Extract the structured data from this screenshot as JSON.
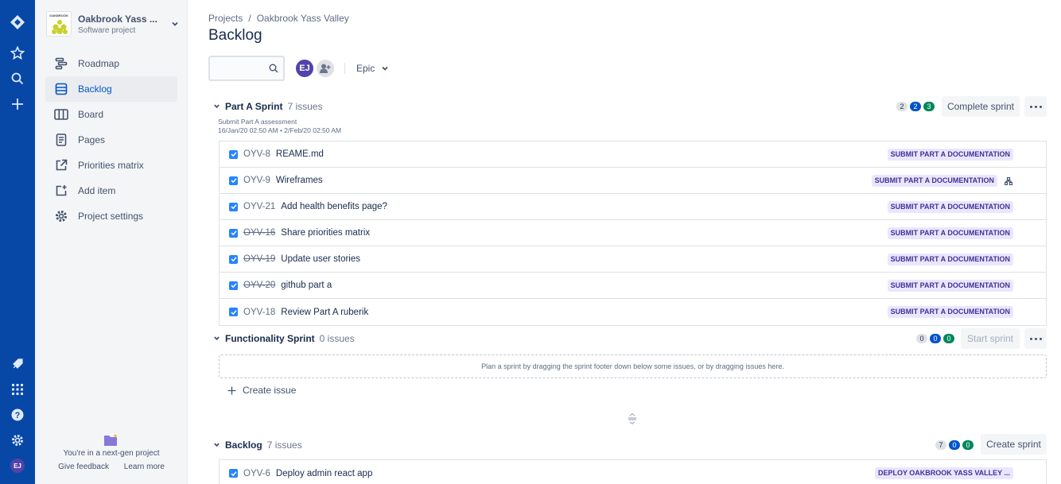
{
  "sidebar": {
    "project_name": "Oakbrook Yass ...",
    "project_type": "Software project",
    "logo_text": "OAKBROOK",
    "items": [
      {
        "label": "Roadmap"
      },
      {
        "label": "Backlog"
      },
      {
        "label": "Board"
      },
      {
        "label": "Pages"
      },
      {
        "label": "Priorities matrix"
      },
      {
        "label": "Add item"
      },
      {
        "label": "Project settings"
      }
    ],
    "footer_text": "You're in a next-gen project",
    "feedback_link": "Give feedback",
    "learn_link": "Learn more"
  },
  "global_nav": {
    "avatar_initials": "EJ"
  },
  "header": {
    "breadcrumb_root": "Projects",
    "breadcrumb_separator": "/",
    "breadcrumb_project": "Oakbrook Yass Valley",
    "title": "Backlog"
  },
  "toolbar": {
    "search_value": "",
    "avatar_initials": "EJ",
    "epic_filter": "Epic"
  },
  "sprint_a": {
    "name": "Part A Sprint",
    "count": "7 issues",
    "goal": "Submit Part A assessment",
    "dates": "16/Jan/20 02:50 AM • 2/Feb/20 02:50 AM",
    "badge_todo": "2",
    "badge_progress": "2",
    "badge_done": "3",
    "action": "Complete sprint",
    "issues": [
      {
        "key": "OYV-8",
        "summary": "REAME.md",
        "epic": "SUBMIT PART A DOCUMENTATION"
      },
      {
        "key": "OYV-9",
        "summary": "Wireframes",
        "epic": "SUBMIT PART A DOCUMENTATION"
      },
      {
        "key": "OYV-21",
        "summary": "Add health benefits page?",
        "epic": "SUBMIT PART A DOCUMENTATION"
      },
      {
        "key": "OYV-16",
        "summary": "Share priorities matrix",
        "epic": "SUBMIT PART A DOCUMENTATION"
      },
      {
        "key": "OYV-19",
        "summary": "Update user stories",
        "epic": "SUBMIT PART A DOCUMENTATION"
      },
      {
        "key": "OYV-20",
        "summary": "github part a",
        "epic": "SUBMIT PART A DOCUMENTATION"
      },
      {
        "key": "OYV-18",
        "summary": "Review Part A ruberik",
        "epic": "SUBMIT PART A DOCUMENTATION"
      }
    ]
  },
  "sprint_f": {
    "name": "Functionality Sprint",
    "count": "0 issues",
    "badge_todo": "0",
    "badge_progress": "0",
    "badge_done": "0",
    "action": "Start sprint",
    "empty_text": "Plan a sprint by dragging the sprint footer down below some issues, or by dragging issues here.",
    "create_issue": "Create issue"
  },
  "backlog": {
    "name": "Backlog",
    "count": "7 issues",
    "badge_todo": "7",
    "badge_progress": "0",
    "badge_done": "0",
    "action": "Create sprint",
    "issues": [
      {
        "key": "OYV-6",
        "summary": "Deploy admin react app",
        "epic": "DEPLOY OAKBROOK YASS VALLEY ..."
      }
    ]
  },
  "colors": {
    "global_nav": "#0747A6",
    "epic_bg": "#EAE6FF",
    "epic_text": "#403294",
    "checkbox": "#2684FF",
    "badge_blue": "#0052CC",
    "badge_green": "#00875A"
  },
  "icons": [
    "jira-logo-icon",
    "star-icon",
    "search-icon",
    "plus-icon",
    "rocket-icon",
    "apps-icon",
    "help-icon",
    "settings-icon",
    "roadmap-icon",
    "backlog-icon",
    "board-icon",
    "pages-icon",
    "external-link-icon",
    "add-item-icon",
    "gear-icon",
    "chevron-down-icon",
    "add-people-icon",
    "subtask-icon",
    "checkbox-icon",
    "folder-icon",
    "more-icon"
  ]
}
